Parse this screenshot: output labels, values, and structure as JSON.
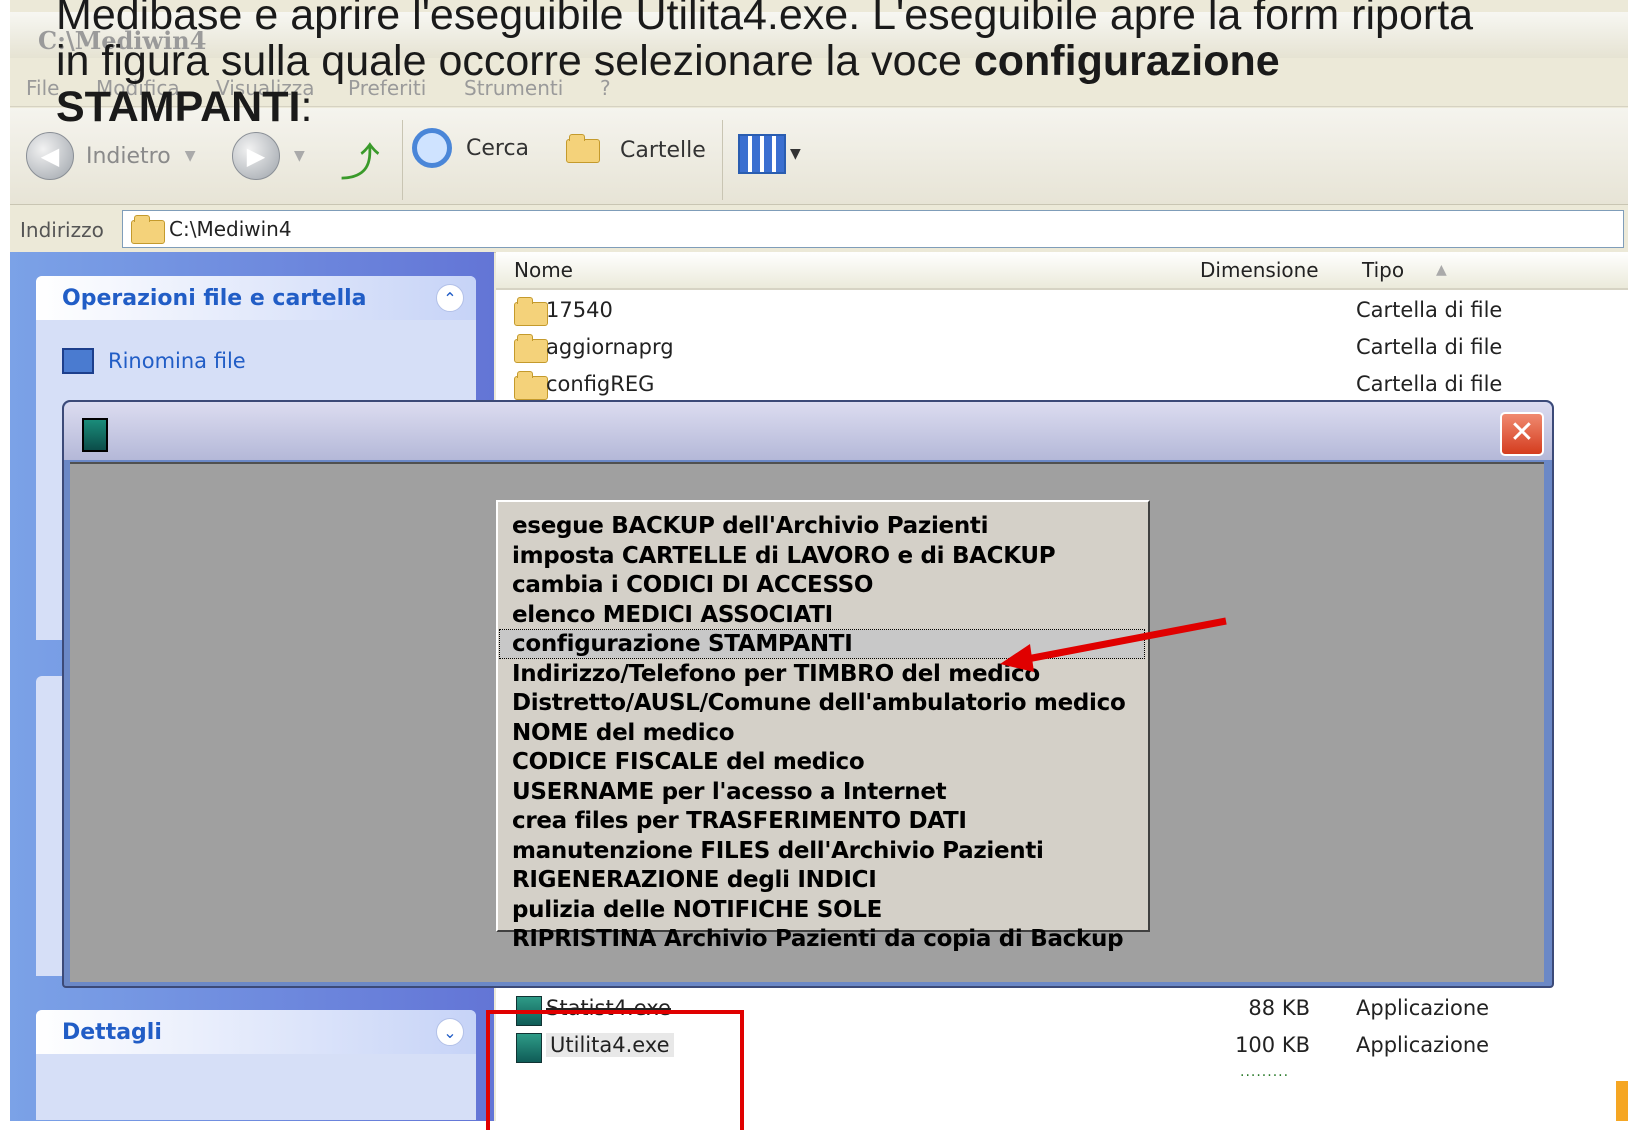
{
  "heading": {
    "line1": "Medibase e aprire l'eseguibile Utilita4.exe. L'eseguibile apre la form riporta",
    "line2_pre": "in figura sulla quale occorre selezionare la voce ",
    "line2_bold": "configurazione",
    "line3_bold": "STAMPANTI",
    "line3_post": ":"
  },
  "window": {
    "title": "C:\\Mediwin4"
  },
  "menubar": {
    "file": "File",
    "modifica": "Modifica",
    "visualizza": "Visualizza",
    "preferiti": "Preferiti",
    "strumenti": "Strumenti",
    "help": "?"
  },
  "toolbar": {
    "back": "Indietro",
    "search": "Cerca",
    "folders": "Cartelle"
  },
  "address": {
    "label": "Indirizzo",
    "value": "C:\\Mediwin4"
  },
  "leftpane": {
    "file_tasks_title": "Operazioni file e cartella",
    "rename": "Rinomina file",
    "details_title": "Dettagli"
  },
  "columns": {
    "name": "Nome",
    "size": "Dimensione",
    "type": "Tipo"
  },
  "files_top": [
    {
      "name": "17540",
      "size": "",
      "type": "Cartella di file"
    },
    {
      "name": "aggiornaprg",
      "size": "",
      "type": "Cartella di file"
    },
    {
      "name": "configREG",
      "size": "",
      "type": "Cartella di file"
    }
  ],
  "files_bottom": [
    {
      "name": "Statist4.exe",
      "size": "88 KB",
      "type": "Applicazione"
    },
    {
      "name": "Utilita4.exe",
      "size": "100 KB",
      "type": "Applicazione"
    }
  ],
  "dialog": {
    "close": "✕",
    "items": [
      "esegue BACKUP dell'Archivio Pazienti",
      "imposta CARTELLE di LAVORO e di BACKUP",
      "cambia i CODICI DI ACCESSO",
      "elenco MEDICI ASSOCIATI",
      "configurazione STAMPANTI",
      "Indirizzo/Telefono per TIMBRO del medico",
      "Distretto/AUSL/Comune dell'ambulatorio medico",
      "NOME del medico",
      "CODICE FISCALE del medico",
      "USERNAME per l'acesso a Internet",
      "crea files per TRASFERIMENTO DATI",
      "manutenzione FILES dell'Archivio Pazienti",
      "RIGENERAZIONE degli INDICI",
      "pulizia delle NOTIFICHE SOLE",
      "RIPRISTINA Archivio Pazienti da copia di Backup"
    ],
    "selected_index": 4
  },
  "colors": {
    "annotation_red": "#e00000",
    "xp_blue": "#215dc6"
  }
}
